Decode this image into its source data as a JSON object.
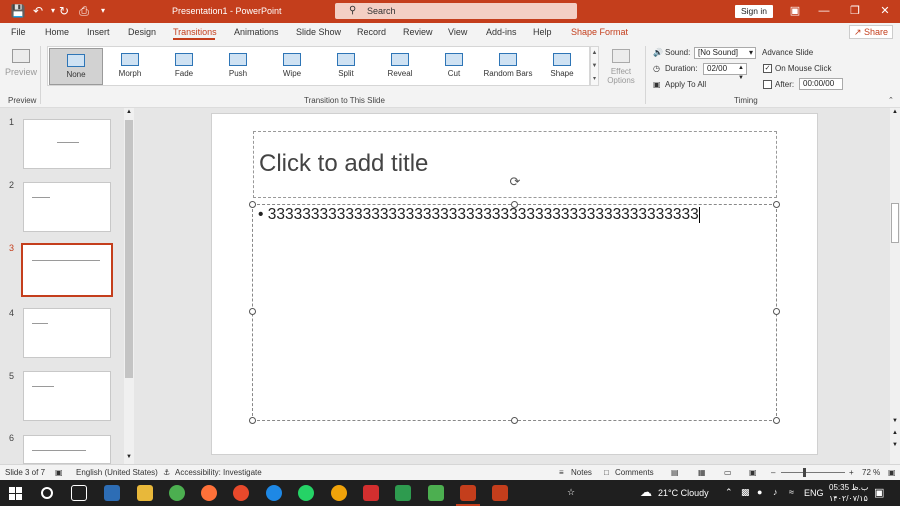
{
  "titlebar": {
    "title": "Presentation1 - PowerPoint",
    "search_placeholder": "Search",
    "sign_in": "Sign in",
    "colors": {
      "brand": "#c43e1c"
    }
  },
  "tabs": [
    {
      "label": "File"
    },
    {
      "label": "Home"
    },
    {
      "label": "Insert"
    },
    {
      "label": "Design"
    },
    {
      "label": "Transitions",
      "active": true
    },
    {
      "label": "Animations"
    },
    {
      "label": "Slide Show"
    },
    {
      "label": "Record"
    },
    {
      "label": "Review"
    },
    {
      "label": "View"
    },
    {
      "label": "Add-ins"
    },
    {
      "label": "Help"
    },
    {
      "label": "Shape Format"
    }
  ],
  "share_label": "Share",
  "ribbon": {
    "preview_label": "Preview",
    "preview_group": "Preview",
    "transitions": [
      "None",
      "Morph",
      "Fade",
      "Push",
      "Wipe",
      "Split",
      "Reveal",
      "Cut",
      "Random Bars",
      "Shape"
    ],
    "selected_transition": "None",
    "transition_group": "Transition to This Slide",
    "effect_options": "Effect Options",
    "sound_label": "Sound:",
    "sound_value": "[No Sound]",
    "duration_label": "Duration:",
    "duration_value": "02/00",
    "apply_all": "Apply To All",
    "advance_slide": "Advance Slide",
    "on_mouse_click": "On Mouse Click",
    "after_label": "After:",
    "after_value": "00:00/00",
    "timing_group": "Timing"
  },
  "thumbnails": [
    {
      "num": "1"
    },
    {
      "num": "2"
    },
    {
      "num": "3",
      "selected": true
    },
    {
      "num": "4"
    },
    {
      "num": "5"
    },
    {
      "num": "6"
    }
  ],
  "slide": {
    "title_placeholder": "Click to add title",
    "bullet": "•",
    "body_text": "33333333333333333333333333333333333333333333333333"
  },
  "status": {
    "slide_count": "Slide 3 of 7",
    "language": "English (United States)",
    "accessibility": "Accessibility: Investigate",
    "notes": "Notes",
    "comments": "Comments",
    "zoom": "72 %"
  },
  "taskbar": {
    "weather": "21°C  Cloudy",
    "lang": "ENG",
    "time": "05:35 ب.ظ",
    "date": "۱۴۰۲/۰۷/۱۵"
  }
}
